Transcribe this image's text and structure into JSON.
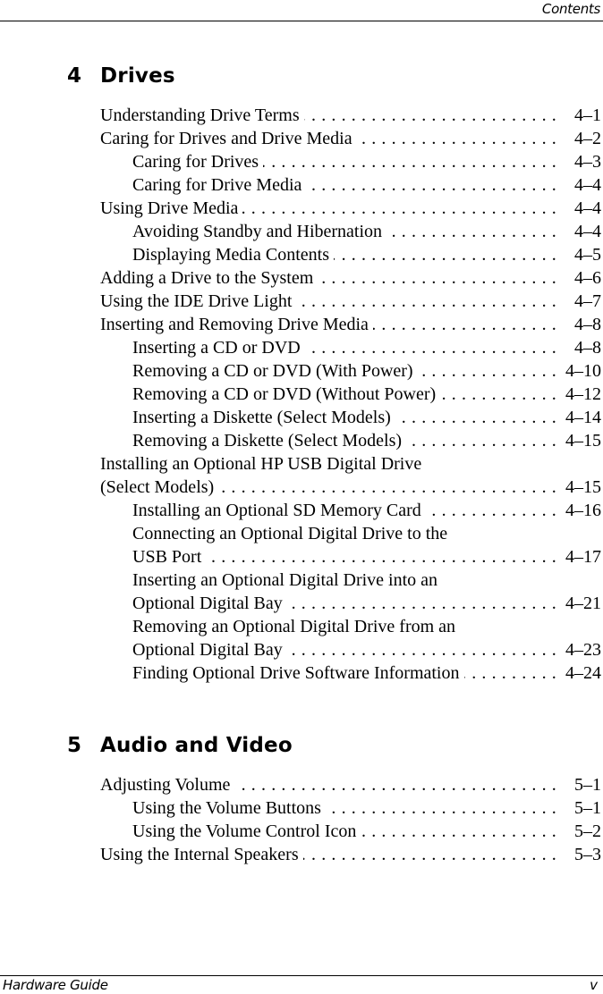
{
  "header": {
    "running_title": "Contents"
  },
  "chapters": [
    {
      "number": "4",
      "title": "Drives",
      "entries": [
        {
          "level": 1,
          "label": "Understanding Drive Terms",
          "page": "4–1"
        },
        {
          "level": 1,
          "label": "Caring for Drives and Drive Media",
          "page": "4–2"
        },
        {
          "level": 2,
          "label": "Caring for Drives",
          "page": "4–3"
        },
        {
          "level": 2,
          "label": "Caring for Drive Media",
          "page": "4–4"
        },
        {
          "level": 1,
          "label": "Using Drive Media",
          "page": "4–4"
        },
        {
          "level": 2,
          "label": "Avoiding Standby and Hibernation",
          "page": "4–4"
        },
        {
          "level": 2,
          "label": "Displaying Media Contents",
          "page": "4–5"
        },
        {
          "level": 1,
          "label": "Adding a Drive to the System",
          "page": "4–6"
        },
        {
          "level": 1,
          "label": "Using the IDE Drive Light",
          "page": "4–7"
        },
        {
          "level": 1,
          "label": "Inserting and Removing Drive Media",
          "page": "4–8"
        },
        {
          "level": 2,
          "label": "Inserting a CD or DVD",
          "page": "4–8"
        },
        {
          "level": 2,
          "label": "Removing a CD or DVD (With Power)",
          "page": "4–10"
        },
        {
          "level": 2,
          "label": "Removing a CD or DVD (Without Power)",
          "page": "4–12"
        },
        {
          "level": 2,
          "label": "Inserting a Diskette (Select Models)",
          "page": "4–14"
        },
        {
          "level": 2,
          "label": "Removing a Diskette (Select Models)",
          "page": "4–15"
        },
        {
          "level": 1,
          "label": "Installing an Optional HP USB Digital Drive",
          "label_cont": "(Select Models)",
          "page": "4–15"
        },
        {
          "level": 2,
          "label": "Installing an Optional SD Memory Card",
          "page": "4–16"
        },
        {
          "level": 2,
          "label": "Connecting an Optional Digital Drive to the",
          "label_cont": "USB Port",
          "page": "4–17"
        },
        {
          "level": 2,
          "label": "Inserting an Optional Digital Drive into an",
          "label_cont": "Optional Digital Bay",
          "page": "4–21"
        },
        {
          "level": 2,
          "label": "Removing an Optional Digital Drive from an",
          "label_cont": "Optional Digital Bay",
          "page": "4–23"
        },
        {
          "level": 2,
          "label": "Finding Optional Drive Software Information",
          "page": "4–24"
        }
      ]
    },
    {
      "number": "5",
      "title": "Audio and Video",
      "entries": [
        {
          "level": 1,
          "label": "Adjusting Volume",
          "page": "5–1"
        },
        {
          "level": 2,
          "label": "Using the Volume Buttons",
          "page": "5–1"
        },
        {
          "level": 2,
          "label": "Using the Volume Control Icon",
          "page": "5–2"
        },
        {
          "level": 1,
          "label": "Using the Internal Speakers",
          "page": "5–3"
        }
      ]
    }
  ],
  "footer": {
    "document_title": "Hardware Guide",
    "page_number": "v"
  }
}
